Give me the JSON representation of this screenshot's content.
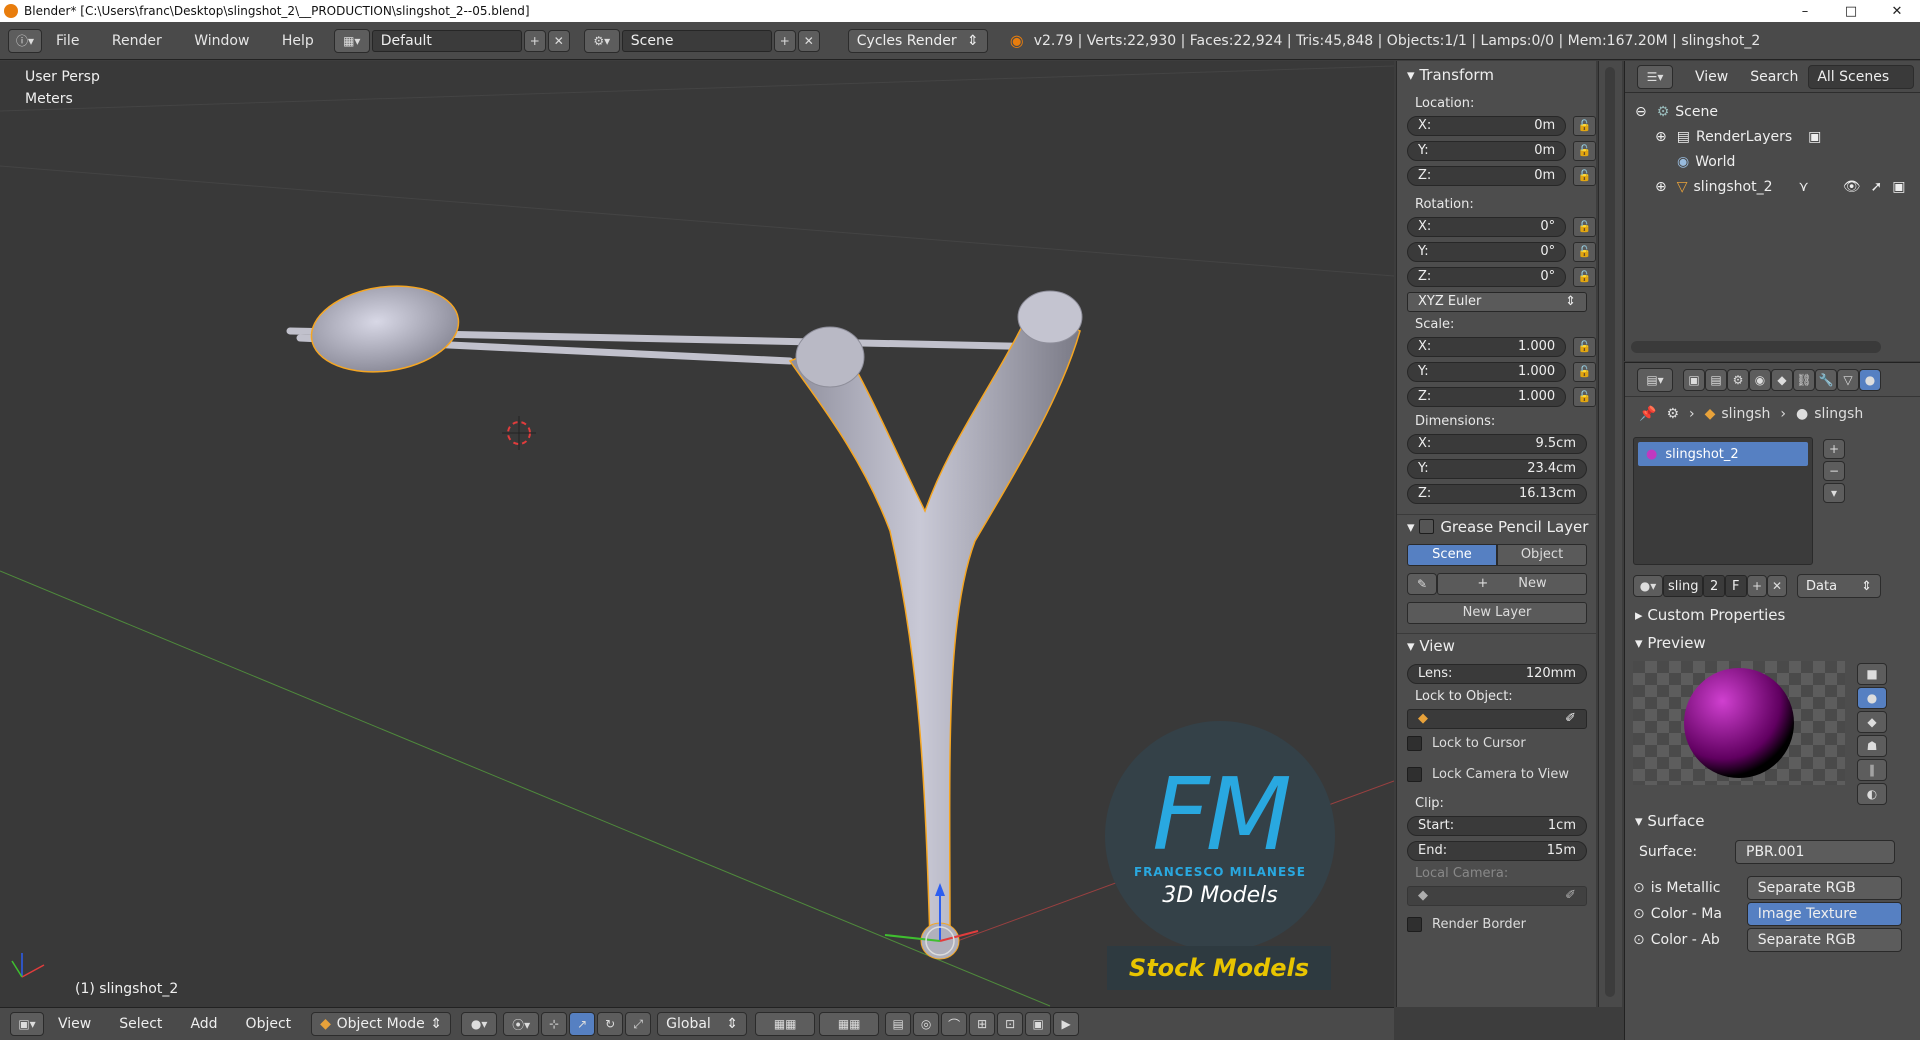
{
  "titlebar": {
    "title": "Blender* [C:\\Users\\franc\\Desktop\\slingshot_2\\__PRODUCTION\\slingshot_2--05.blend]",
    "minimize": "–",
    "maximize": "□",
    "close": "✕"
  },
  "infobar": {
    "menus": [
      "File",
      "Render",
      "Window",
      "Help"
    ],
    "layout": "Default",
    "scene": "Scene",
    "engine": "Cycles Render",
    "stats": "v2.79 | Verts:22,930 | Faces:22,924 | Tris:45,848 | Objects:1/1 | Lamps:0/0 | Mem:167.20M | slingshot_2"
  },
  "viewport": {
    "view_name": "User Persp",
    "units": "Meters",
    "object_label": "(1) slingshot_2",
    "watermark_initials": "FM",
    "watermark_name": "FRANCESCO MILANESE",
    "watermark_sub": "3D Models",
    "watermark_stock": "Stock Models",
    "colors": {
      "accent": "#29a8e0",
      "selection": "#f5a623",
      "stock": "#e8c400"
    }
  },
  "viewport_header": {
    "items": [
      "View",
      "Select",
      "Add",
      "Object"
    ],
    "mode": "Object Mode",
    "orientation": "Global"
  },
  "npanel": {
    "transform_title": "Transform",
    "location_label": "Location:",
    "location": [
      {
        "axis": "X:",
        "value": "0m"
      },
      {
        "axis": "Y:",
        "value": "0m"
      },
      {
        "axis": "Z:",
        "value": "0m"
      }
    ],
    "rotation_label": "Rotation:",
    "rotation": [
      {
        "axis": "X:",
        "value": "0°"
      },
      {
        "axis": "Y:",
        "value": "0°"
      },
      {
        "axis": "Z:",
        "value": "0°"
      }
    ],
    "rotation_mode": "XYZ Euler",
    "scale_label": "Scale:",
    "scale": [
      {
        "axis": "X:",
        "value": "1.000"
      },
      {
        "axis": "Y:",
        "value": "1.000"
      },
      {
        "axis": "Z:",
        "value": "1.000"
      }
    ],
    "dimensions_label": "Dimensions:",
    "dimensions": [
      {
        "axis": "X:",
        "value": "9.5cm"
      },
      {
        "axis": "Y:",
        "value": "23.4cm"
      },
      {
        "axis": "Z:",
        "value": "16.13cm"
      }
    ],
    "grease_title": "Grease Pencil Layer",
    "grease_scene": "Scene",
    "grease_object": "Object",
    "grease_new": "New",
    "grease_new_layer": "New Layer",
    "view_title": "View",
    "lens_label": "Lens:",
    "lens_value": "120mm",
    "lock_object_label": "Lock to Object:",
    "lock_cursor": "Lock to Cursor",
    "lock_camera": "Lock Camera to View",
    "clip_label": "Clip:",
    "clip_start_label": "Start:",
    "clip_start": "1cm",
    "clip_end_label": "End:",
    "clip_end": "15m",
    "local_camera": "Local Camera:",
    "render_border": "Render Border"
  },
  "outliner": {
    "header_view": "View",
    "header_search": "Search",
    "header_filter": "All Scenes",
    "rows": [
      {
        "label": "Scene"
      },
      {
        "label": "RenderLayers"
      },
      {
        "label": "World"
      },
      {
        "label": "slingshot_2"
      }
    ]
  },
  "properties": {
    "breadcrumb_object": "slingsh",
    "breadcrumb_material": "slingsh",
    "material_slot": "slingshot_2",
    "datablock_name": "sling",
    "datablock_users": "2",
    "datablock_fake": "F",
    "link_type": "Data",
    "custom_props": "Custom Properties",
    "preview_title": "Preview",
    "surface_title": "Surface",
    "surface_label": "Surface:",
    "surface_value": "PBR.001",
    "inputs": [
      {
        "name": "is Metallic",
        "value": "Separate RGB"
      },
      {
        "name": "Color - Ma",
        "value": "Image Texture"
      },
      {
        "name": "Color - Ab",
        "value": "Separate RGB"
      }
    ]
  }
}
